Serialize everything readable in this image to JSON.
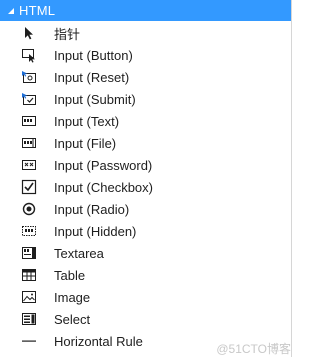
{
  "header": {
    "title": "HTML",
    "expand_icon": "triangle-down-icon"
  },
  "items": [
    {
      "label": "指针",
      "icon": "pointer-icon"
    },
    {
      "label": "Input (Button)",
      "icon": "input-button-icon"
    },
    {
      "label": "Input (Reset)",
      "icon": "input-reset-icon"
    },
    {
      "label": "Input (Submit)",
      "icon": "input-submit-icon"
    },
    {
      "label": "Input (Text)",
      "icon": "input-text-icon"
    },
    {
      "label": "Input (File)",
      "icon": "input-file-icon"
    },
    {
      "label": "Input (Password)",
      "icon": "input-password-icon"
    },
    {
      "label": "Input (Checkbox)",
      "icon": "checkbox-icon"
    },
    {
      "label": "Input (Radio)",
      "icon": "radio-icon"
    },
    {
      "label": "Input (Hidden)",
      "icon": "input-hidden-icon"
    },
    {
      "label": "Textarea",
      "icon": "textarea-icon"
    },
    {
      "label": "Table",
      "icon": "table-icon"
    },
    {
      "label": "Image",
      "icon": "image-icon"
    },
    {
      "label": "Select",
      "icon": "select-icon"
    },
    {
      "label": "Horizontal Rule",
      "icon": "horizontal-rule-icon"
    }
  ],
  "watermark": "@51CTO博客",
  "colors": {
    "header_bg": "#3399ff",
    "header_text": "#ffffff",
    "text": "#1e1e1e",
    "icon": "#1e1e1e",
    "icon_accent": "#1e6fd9"
  }
}
